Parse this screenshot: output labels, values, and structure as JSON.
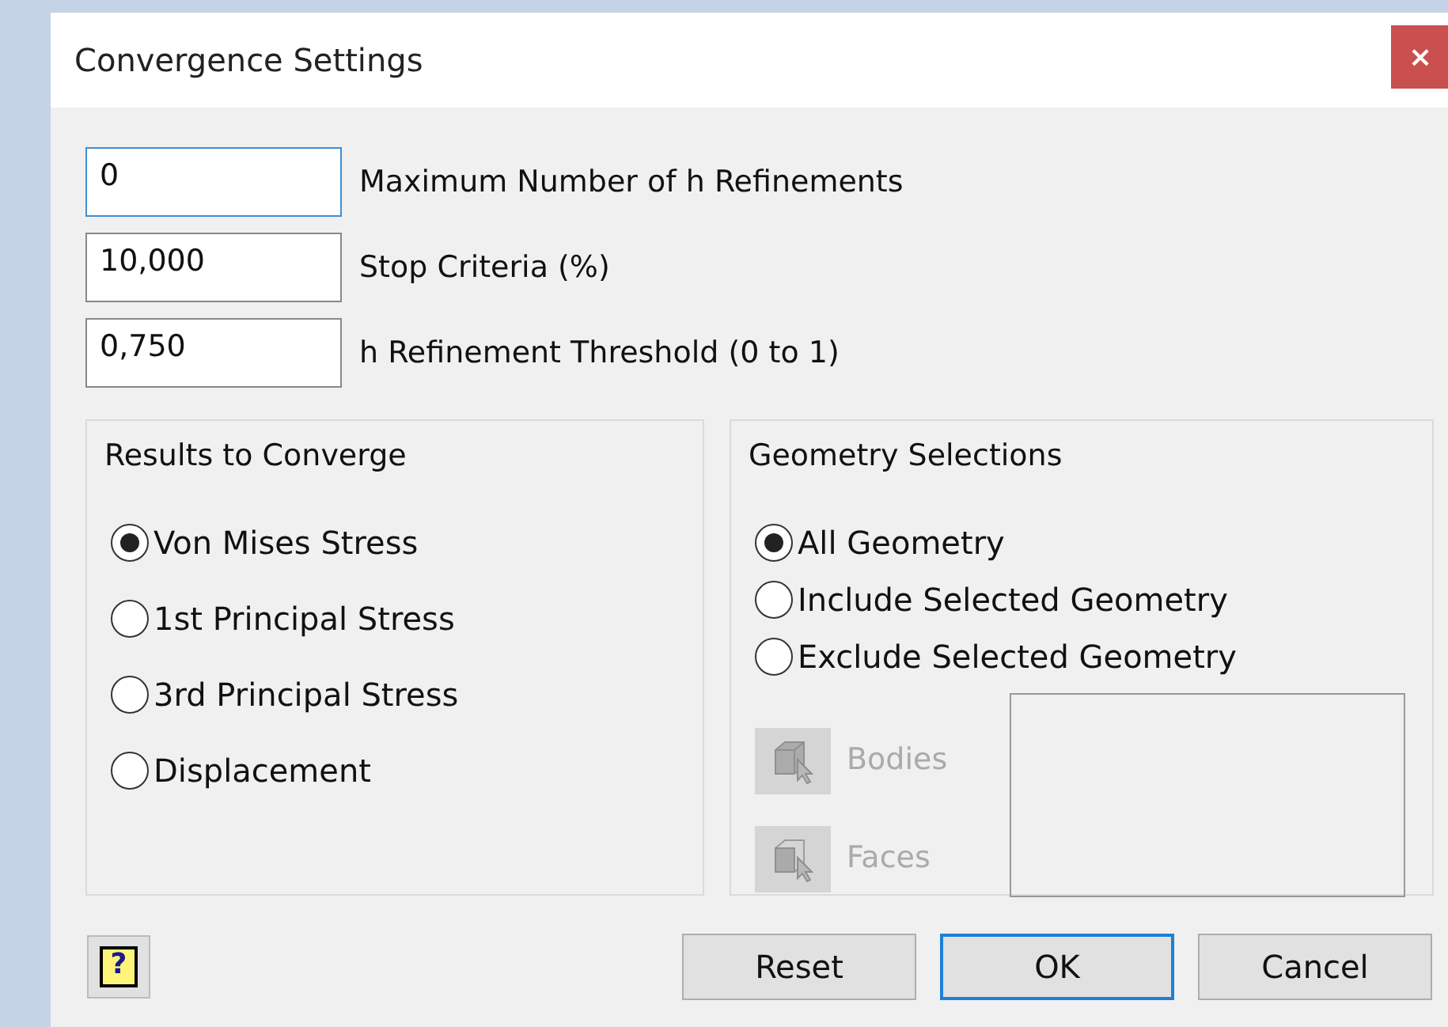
{
  "window": {
    "title": "Convergence Settings",
    "close": "×"
  },
  "fields": [
    {
      "value": "0",
      "label": "Maximum Number of h Refinements",
      "focused": true
    },
    {
      "value": "10,000",
      "label": "Stop Criteria (%)",
      "focused": false
    },
    {
      "value": "0,750",
      "label": "h Refinement Threshold (0 to 1)",
      "focused": false
    }
  ],
  "results_group": {
    "title": "Results to Converge",
    "options": [
      {
        "label": "Von Mises Stress",
        "selected": true
      },
      {
        "label": "1st Principal Stress",
        "selected": false
      },
      {
        "label": "3rd Principal Stress",
        "selected": false
      },
      {
        "label": "Displacement",
        "selected": false
      }
    ]
  },
  "geometry_group": {
    "title": "Geometry Selections",
    "options": [
      {
        "label": "All Geometry",
        "selected": true
      },
      {
        "label": "Include Selected Geometry",
        "selected": false
      },
      {
        "label": "Exclude Selected Geometry",
        "selected": false
      }
    ],
    "pickers": [
      {
        "kind": "bodies",
        "label": "Bodies",
        "disabled": true
      },
      {
        "kind": "faces",
        "label": "Faces",
        "disabled": true
      }
    ]
  },
  "help_button": {
    "label": "?"
  },
  "buttons": [
    {
      "label": "Reset",
      "default": false
    },
    {
      "label": "OK",
      "default": true
    },
    {
      "label": "Cancel",
      "default": false
    }
  ]
}
